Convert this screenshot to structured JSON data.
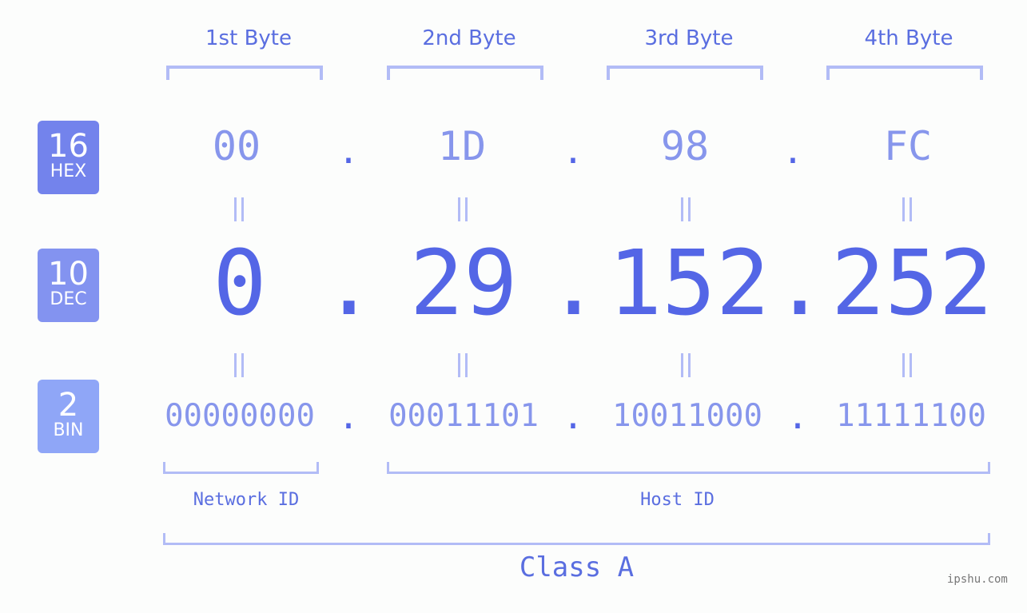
{
  "bytes": [
    {
      "label": "1st Byte",
      "hex": "00",
      "dec": "0",
      "bin": "00000000"
    },
    {
      "label": "2nd Byte",
      "hex": "1D",
      "dec": "29",
      "bin": "00011101"
    },
    {
      "label": "3rd Byte",
      "hex": "98",
      "dec": "152",
      "bin": "10011000"
    },
    {
      "label": "4th Byte",
      "hex": "FC",
      "dec": "252",
      "bin": "11111100"
    }
  ],
  "separator": ".",
  "badges": {
    "hex": {
      "base": "16",
      "name": "HEX",
      "color": "#7383ec"
    },
    "dec": {
      "base": "10",
      "name": "DEC",
      "color": "#8393f0"
    },
    "bin": {
      "base": "2",
      "name": "BIN",
      "color": "#8fa6f7"
    }
  },
  "segments": {
    "network": "Network ID",
    "host": "Host ID"
  },
  "ip_class": "Class A",
  "watermark": "ipshu.com",
  "colors": {
    "accent": "#5466e6",
    "light": "#8796ec",
    "bracket": "#b2bcf6"
  }
}
